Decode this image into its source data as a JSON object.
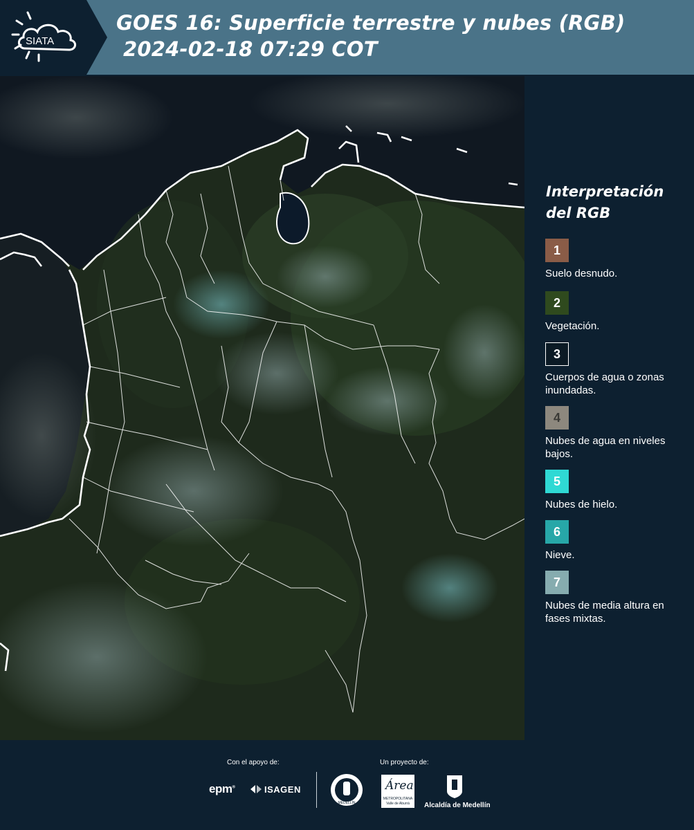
{
  "header": {
    "logo_text": "SIATA",
    "title_line1": "GOES 16: Superficie terrestre y nubes (RGB)",
    "title_line2": "2024-02-18 07:29 COT"
  },
  "legend": {
    "title_line1": "Interpretación",
    "title_line2": "del RGB",
    "items": [
      {
        "number": "1",
        "color": "#8a5c47",
        "label": "Suelo desnudo."
      },
      {
        "number": "2",
        "color": "#2f4a1e",
        "label": "Vegetación."
      },
      {
        "number": "3",
        "color": "#0b1a25",
        "label": "Cuerpos de agua o zonas inundadas."
      },
      {
        "number": "4",
        "color": "#8d887e",
        "label": "Nubes de agua en niveles bajos."
      },
      {
        "number": "5",
        "color": "#2fd9d4",
        "label": "Nubes de hielo."
      },
      {
        "number": "6",
        "color": "#27a7a8",
        "label": "Nieve."
      },
      {
        "number": "7",
        "color": "#86acaf",
        "label": "Nubes de media altura en fases mixtas."
      }
    ]
  },
  "footer": {
    "support_label": "Con el apoyo de:",
    "project_label": "Un proyecto de:",
    "epm_logo": "epm",
    "isagen_logo": "ISAGEN",
    "area_logo": "Área",
    "area_sub": "METROPOLITANA",
    "area_sub2": "Valle de Aburrá",
    "alcaldia": "Alcaldía de Medellín",
    "seal_text": "MEDELLÍN"
  }
}
